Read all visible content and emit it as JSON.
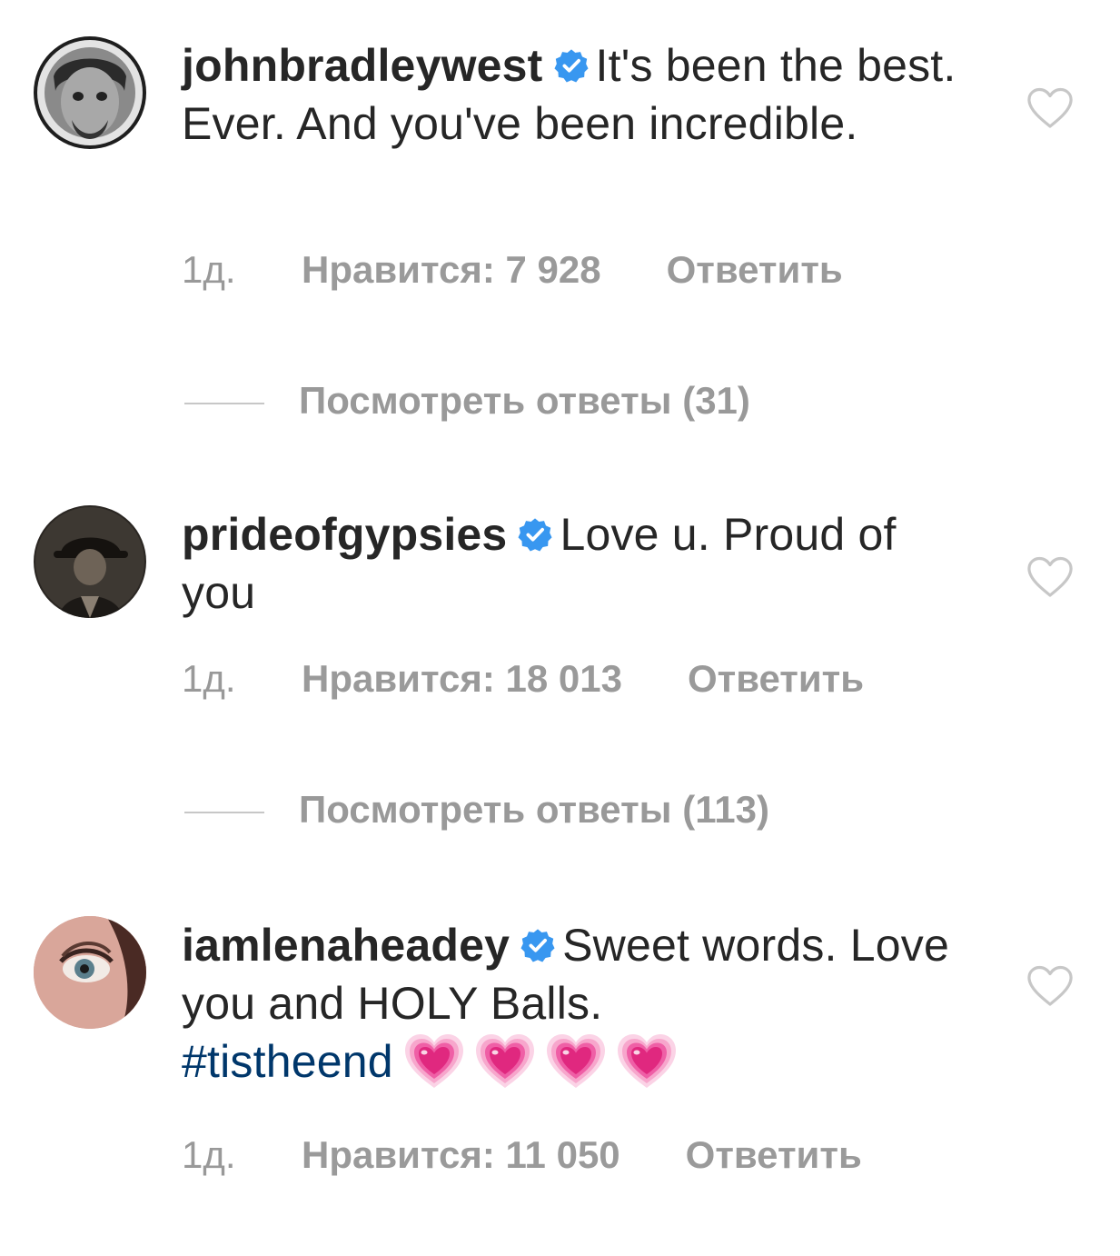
{
  "comments": [
    {
      "username": "johnbradleywest",
      "verified_icon": "verified-badge-icon",
      "text": "It's been the best. Ever. And you've been incredible.",
      "time": "1д.",
      "likes_label": "Нравится: 7 928",
      "reply_label": "Ответить",
      "view_replies_label": "Посмотреть ответы (31)"
    },
    {
      "username": "prideofgypsies",
      "verified_icon": "verified-badge-icon",
      "text": "Love u. Proud of you",
      "time": "1д.",
      "likes_label": "Нравится: 18 013",
      "reply_label": "Ответить",
      "view_replies_label": "Посмотреть ответы (113)"
    },
    {
      "username": "iamlenaheadey",
      "verified_icon": "verified-badge-icon",
      "text": "Sweet words. Love you and HOLY Balls.",
      "hashtag": "#tistheend",
      "emoji": [
        "growing-heart-emoji",
        "growing-heart-emoji",
        "growing-heart-emoji",
        "growing-heart-emoji"
      ],
      "time": "1д.",
      "likes_label": "Нравится: 11 050",
      "reply_label": "Ответить"
    }
  ],
  "colors": {
    "text": "#262626",
    "meta": "#999999",
    "verified": "#3897f0",
    "hashtag": "#00376b",
    "heart_outline": "#c7c7c7",
    "emoji_heart": "#f06ab0"
  }
}
